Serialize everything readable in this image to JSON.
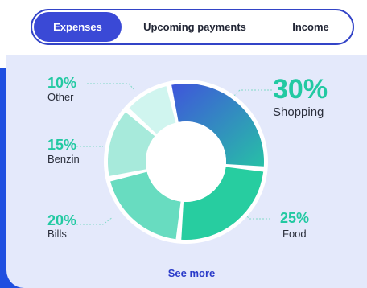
{
  "tabs": [
    {
      "label": "Expenses",
      "active": true
    },
    {
      "label": "Upcoming payments",
      "active": false
    },
    {
      "label": "Income",
      "active": false
    }
  ],
  "segments": [
    {
      "name": "Shopping",
      "percent": "30%",
      "value": 30,
      "color": "#3f63d8",
      "color_end": "#2bb3a8"
    },
    {
      "name": "Food",
      "percent": "25%",
      "value": 25,
      "color": "#27cda0"
    },
    {
      "name": "Bills",
      "percent": "20%",
      "value": 20,
      "color": "#68dcc0"
    },
    {
      "name": "Benzin",
      "percent": "15%",
      "value": 15,
      "color": "#a7eadb"
    },
    {
      "name": "Other",
      "percent": "10%",
      "value": 10,
      "color": "#d0f5ef"
    }
  ],
  "see_more_label": "See more",
  "colors": {
    "accent": "#3a49d6",
    "teal": "#22c9a2",
    "card_bg": "#e4e9fb",
    "edge_blue": "#1f4fe0"
  }
}
